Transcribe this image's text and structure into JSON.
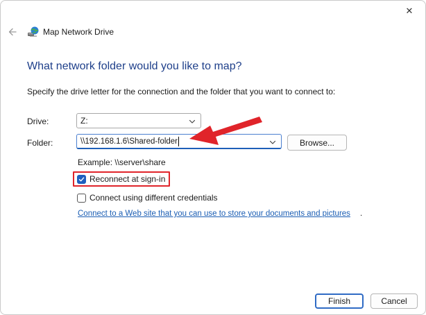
{
  "window": {
    "title": "Map Network Drive",
    "close_glyph": "✕",
    "back_icon": "arrow-left-icon",
    "app_icon": "network-drive-icon"
  },
  "main": {
    "heading": "What network folder would you like to map?",
    "instruction": "Specify the drive letter for the connection and the folder that you want to connect to:",
    "drive": {
      "label": "Drive:",
      "value": "Z:"
    },
    "folder": {
      "label": "Folder:",
      "value": "\\\\192.168.1.6\\Shared-folder"
    },
    "browse_label": "Browse...",
    "example": "Example: \\\\server\\share",
    "reconnect": {
      "label": "Reconnect at sign-in",
      "checked": true
    },
    "different_credentials": {
      "label": "Connect using different credentials",
      "checked": false
    },
    "link_text": "Connect to a Web site that you can use to store your documents and pictures",
    "link_suffix": "."
  },
  "footer": {
    "finish_label": "Finish",
    "cancel_label": "Cancel"
  },
  "colors": {
    "heading": "#1e3f8a",
    "accent": "#1f5fbf",
    "annotation_red": "#e0242a",
    "link": "#1a5db3"
  }
}
